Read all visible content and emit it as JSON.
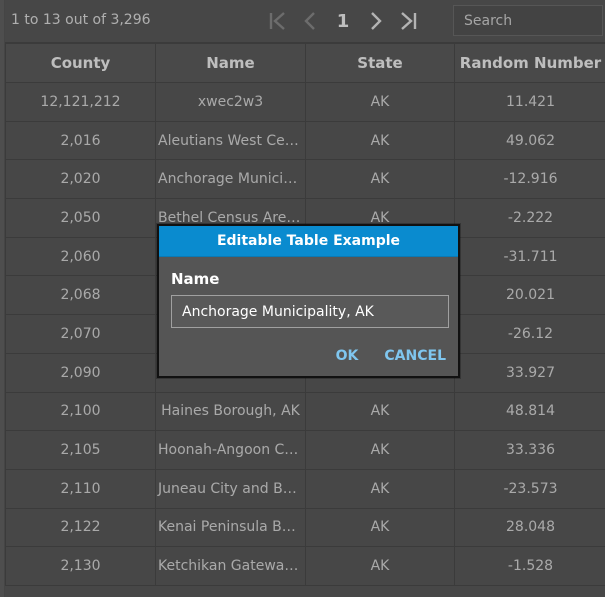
{
  "toolbar": {
    "summary": "1 to 13 out of 3,296",
    "current_page": "1",
    "search_placeholder": "Search",
    "icons": {
      "first": "first-page-icon",
      "previous": "previous-page-icon",
      "next": "next-page-icon",
      "last": "last-page-icon"
    }
  },
  "table": {
    "columns": [
      "County",
      "Name",
      "State",
      "Random Number"
    ],
    "rows": [
      [
        "12,121,212",
        "xwec2w3",
        "AK",
        "11.421"
      ],
      [
        "2,016",
        "Aleutians West Census Area, AK",
        "AK",
        "49.062"
      ],
      [
        "2,020",
        "Anchorage Municipality, AK",
        "AK",
        "-12.916"
      ],
      [
        "2,050",
        "Bethel Census Area, AK",
        "AK",
        "-2.222"
      ],
      [
        "2,060",
        "",
        "",
        "-31.711"
      ],
      [
        "2,068",
        "",
        "",
        "20.021"
      ],
      [
        "2,070",
        "",
        "",
        "-26.12"
      ],
      [
        "2,090",
        "",
        "",
        "33.927"
      ],
      [
        "2,100",
        "Haines Borough, AK",
        "AK",
        "48.814"
      ],
      [
        "2,105",
        "Hoonah-Angoon Census Area, AK",
        "AK",
        "33.336"
      ],
      [
        "2,110",
        "Juneau City and Borough, AK",
        "AK",
        "-23.573"
      ],
      [
        "2,122",
        "Kenai Peninsula Borough, AK",
        "AK",
        "28.048"
      ],
      [
        "2,130",
        "Ketchikan Gateway Borough, AK",
        "AK",
        "-1.528"
      ]
    ]
  },
  "dialog": {
    "title": "Editable Table Example",
    "field_label": "Name",
    "field_value": "Anchorage Municipality, AK",
    "ok_label": "OK",
    "cancel_label": "CANCEL"
  },
  "colors": {
    "background": "#5a5a5a",
    "title_bar": "#0a8bcf",
    "action_text": "#7fc6ef"
  }
}
